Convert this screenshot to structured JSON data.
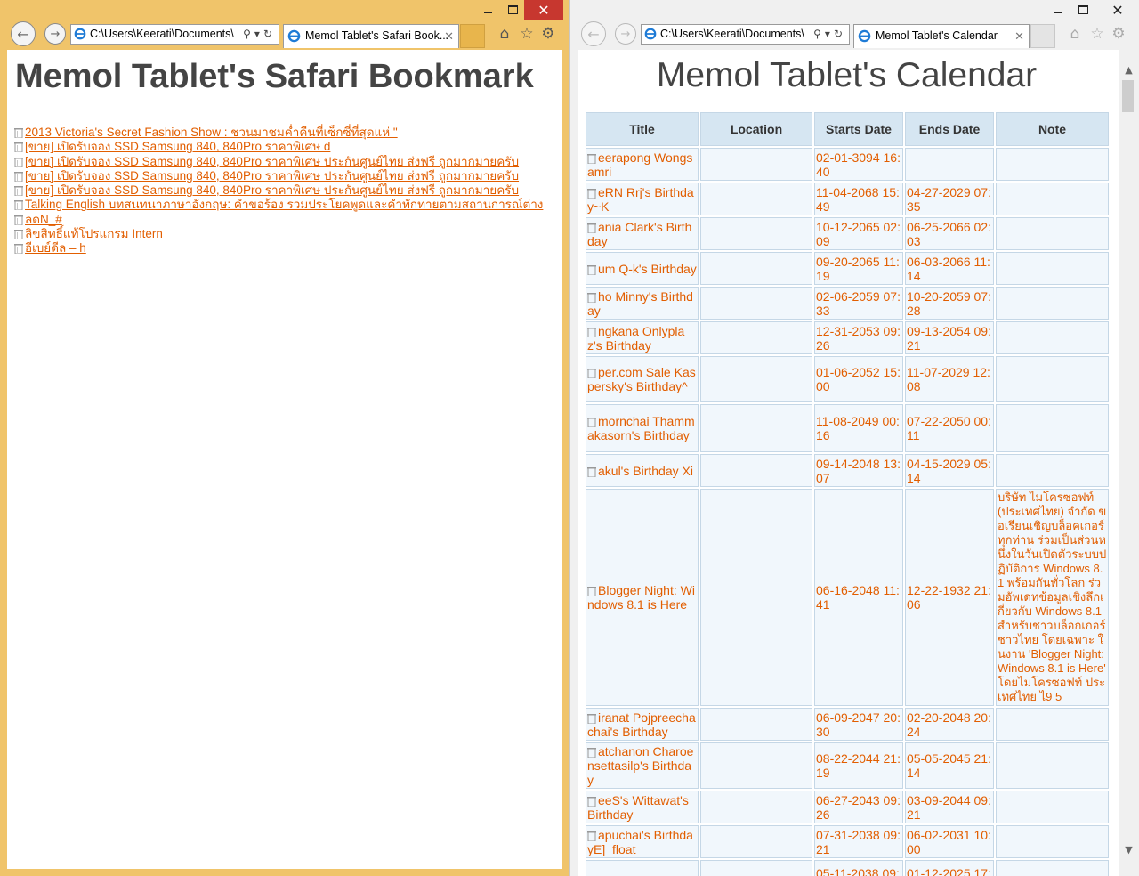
{
  "left_window": {
    "address": "C:\\Users\\Keerati\\Documents\\",
    "tab_title": "Memol Tablet's Safari Book...",
    "page_title": "Memol Tablet's Safari Bookmark",
    "bookmarks": [
      "2013 Victoria's Secret Fashion Show : ชวนมาชมค่ำคืนที่เซ็กซี่ที่สุดแห่ \"",
      "[ขาย] เปิดรับจอง SSD Samsung 840, 840Pro ราคาพิเศษ d",
      "[ขาย] เปิดรับจอง SSD Samsung 840, 840Pro ราคาพิเศษ ประกันศูนย์ไทย ส่งฟรี ถูกมากมายครับ",
      "[ขาย] เปิดรับจอง SSD Samsung 840, 840Pro ราคาพิเศษ ประกันศูนย์ไทย ส่งฟรี ถูกมากมายครับ",
      "[ขาย] เปิดรับจอง SSD Samsung 840, 840Pro ราคาพิเศษ ประกันศูนย์ไทย ส่งฟรี ถูกมากมายครับ",
      "Talking English บทสนทนาภาษาอังกฤษ: คำขอร้อง รวมประโยคพูดและคำทักทายตามสถานการณ์ต่าง",
      "ลดN_#",
      "ลิขสิทธิ์แท้โปรแกรม Intern",
      "อีเบย์ดีล – h"
    ]
  },
  "right_window": {
    "address": "C:\\Users\\Keerati\\Documents\\",
    "tab_title": "Memol Tablet's Calendar",
    "page_title": "Memol Tablet's Calendar",
    "columns": [
      "Title",
      "Location",
      "Starts Date",
      "Ends Date",
      "Note"
    ],
    "rows": [
      {
        "title": "eerapong Wongsamri",
        "location": "",
        "start": "02-01-3094 16:40",
        "end": "",
        "note": ""
      },
      {
        "title": "eRN Rrj's Birthday~K",
        "location": "",
        "start": "11-04-2068 15:49",
        "end": "04-27-2029 07:35",
        "note": ""
      },
      {
        "title": "ania Clark's Birthday",
        "location": "",
        "start": "10-12-2065 02:09",
        "end": "06-25-2066 02:03",
        "note": ""
      },
      {
        "title": "um Q-k's Birthday",
        "location": "",
        "start": "09-20-2065 11:19",
        "end": "06-03-2066 11:14",
        "note": ""
      },
      {
        "title": "ho Minny's Birthday",
        "location": "",
        "start": "02-06-2059 07:33",
        "end": "10-20-2059 07:28",
        "note": ""
      },
      {
        "title": "ngkana Onlyplaz's Birthday",
        "location": "",
        "start": "12-31-2053 09:26",
        "end": "09-13-2054 09:21",
        "note": ""
      },
      {
        "title": "per.com Sale Kaspersky's Birthday^",
        "location": "",
        "start": "01-06-2052 15:00",
        "end": "11-07-2029 12:08",
        "note": ""
      },
      {
        "title": "mornchai Thammakasorn's Birthday",
        "location": "",
        "start": "11-08-2049 00:16",
        "end": "07-22-2050 00:11",
        "note": ""
      },
      {
        "title": "akul's Birthday Xi",
        "location": "",
        "start": "09-14-2048 13:07",
        "end": "04-15-2029 05:14",
        "note": ""
      },
      {
        "title": "Blogger Night: Windows 8.1 is Here",
        "location": "",
        "start": "06-16-2048 11:41",
        "end": "12-22-1932 21:06",
        "note": "บริษัท ไมโครซอฟท์ (ประเทศไทย) จำกัด ขอเรียนเชิญบล็อคเกอร์ทุกท่าน ร่วมเป็นส่วนหนึ่งในวันเปิดตัวระบบปฏิบัติการ Windows 8.1 พร้อมกันทั่วโลก ร่วมอัพเดทข้อมูลเชิงลึกเกี่ยวกับ Windows 8.1 สำหรับชาวบล็อกเกอร์ชาวไทย โดยเฉพาะ ในงาน 'Blogger Night: Windows 8.1 is Here' โดยไมโครซอฟท์ ประเทศไทย ไ9 5"
      },
      {
        "title": "iranat Pojpreechachai's Birthday",
        "location": "",
        "start": "06-09-2047 20:30",
        "end": "02-20-2048 20:24",
        "note": ""
      },
      {
        "title": "atchanon Charoensettasilp's Birthday",
        "location": "",
        "start": "08-22-2044 21:19",
        "end": "05-05-2045 21:14",
        "note": ""
      },
      {
        "title": "eeS's Wittawat's Birthday",
        "location": "",
        "start": "06-27-2043 09:26",
        "end": "03-09-2044 09:21",
        "note": ""
      },
      {
        "title": "apuchai's BirthdayE]_float",
        "location": "",
        "start": "07-31-2038 09:21",
        "end": "06-02-2031 10:00",
        "note": ""
      },
      {
        "title": "",
        "location": "",
        "start": "05-11-2038 09:",
        "end": "01-12-2025 17:",
        "note": ""
      }
    ]
  },
  "colors": {
    "link": "#e25e00",
    "left_frame": "#f0c46a",
    "close_button": "#c7372f",
    "table_header": "#d6e6f2",
    "table_cell": "#f1f7fc"
  }
}
